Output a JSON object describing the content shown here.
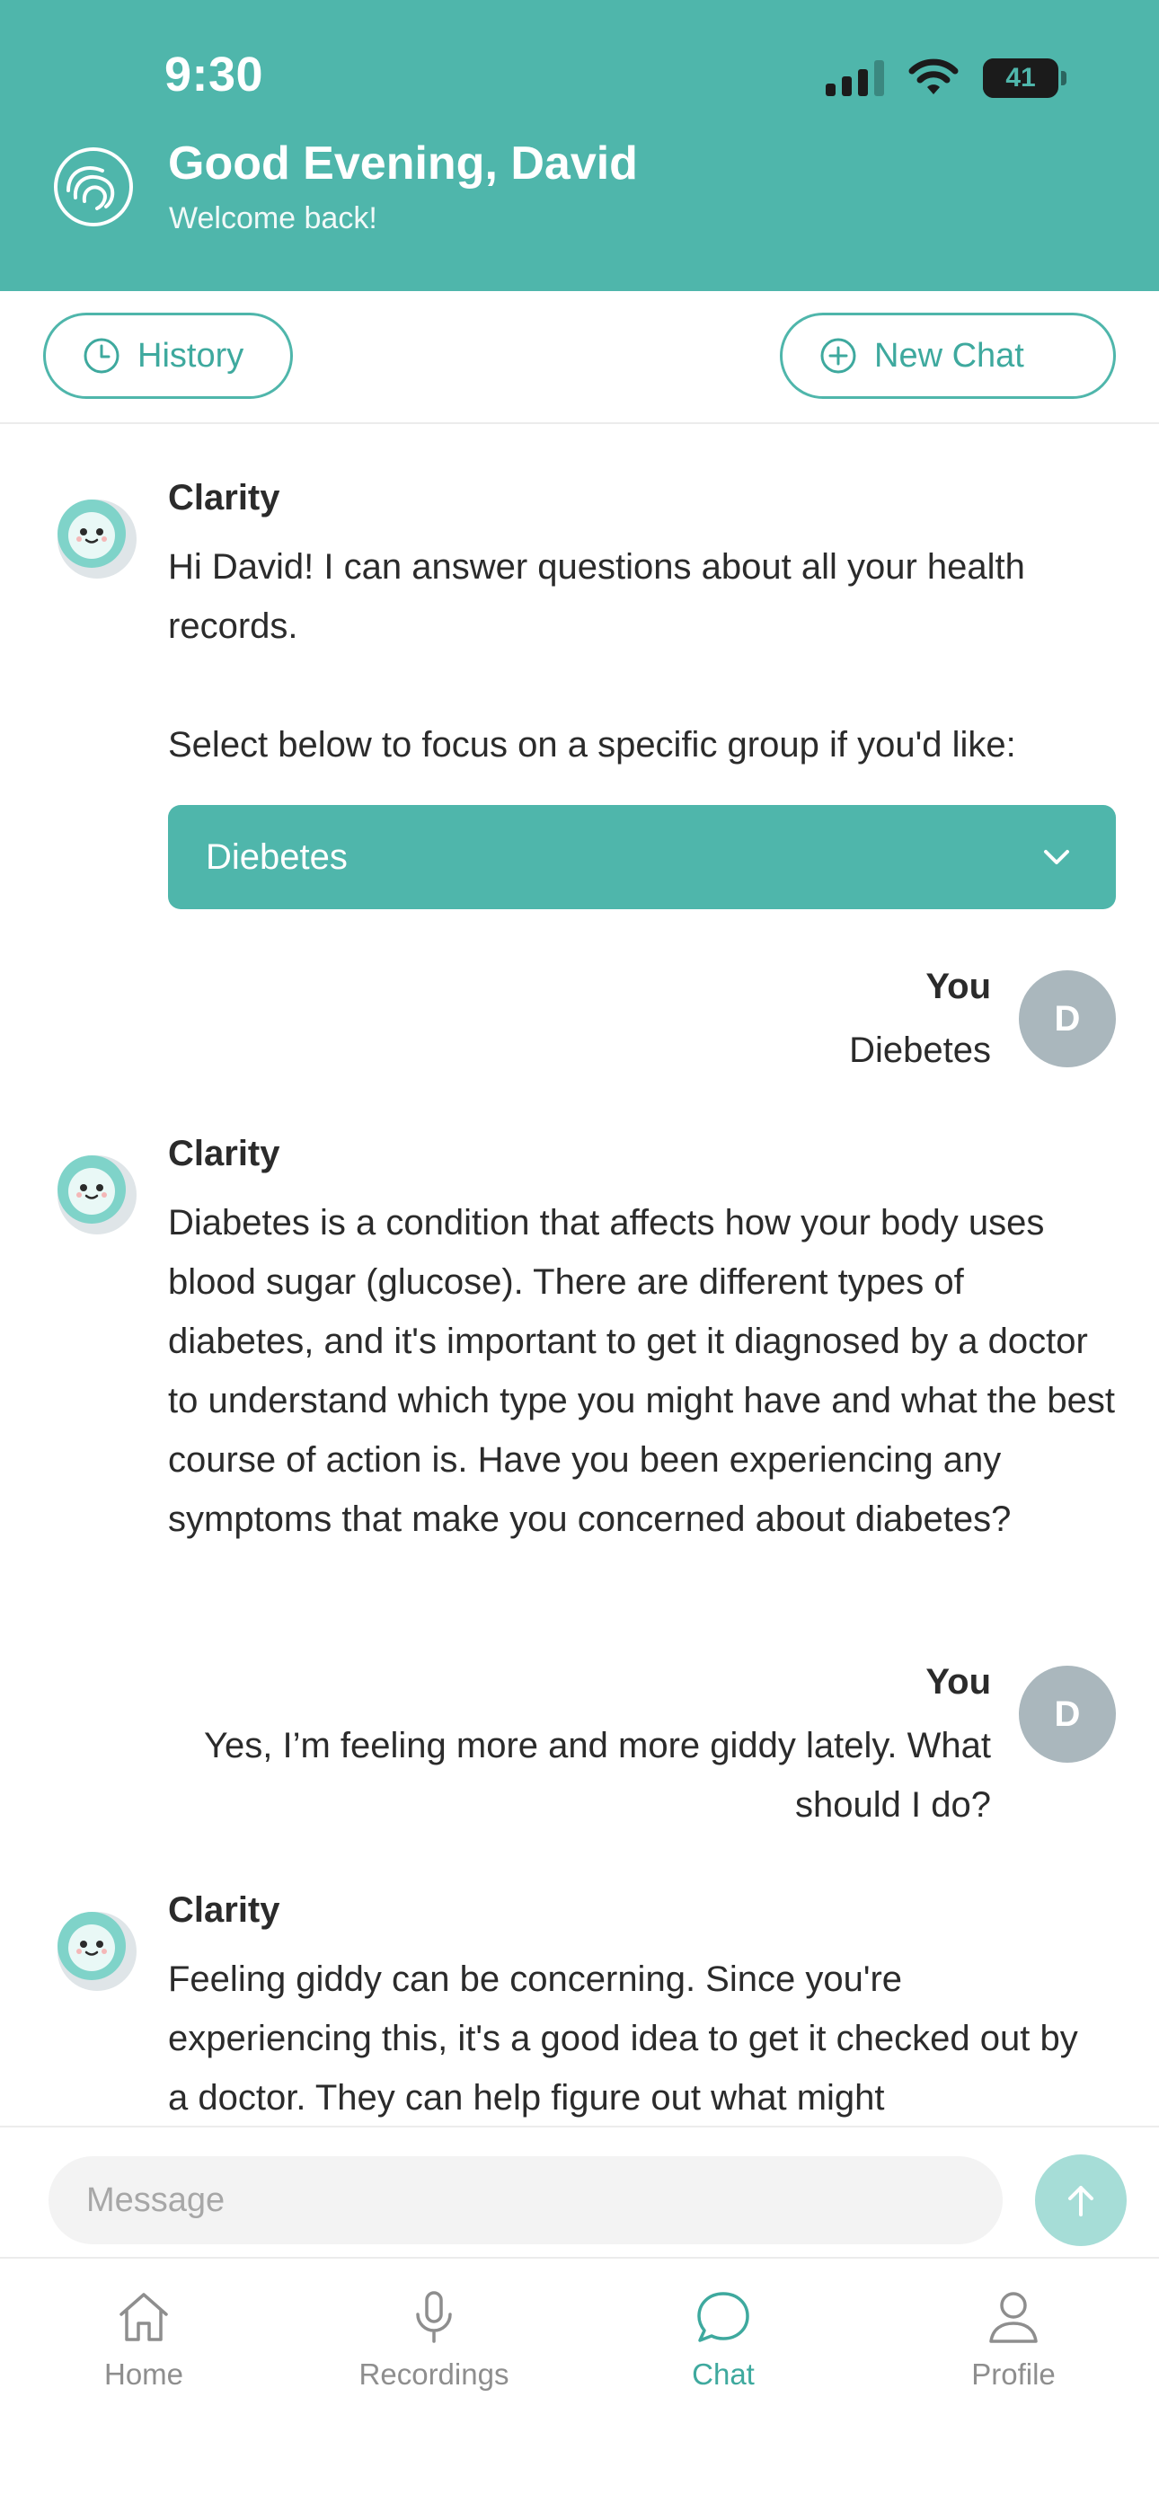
{
  "status_bar": {
    "time": "9:30",
    "battery": "41",
    "battery_level": 0.41
  },
  "header": {
    "greeting": "Good Evening, David",
    "subtitle": "Welcome back!",
    "logo_icon": "swirl-logo-icon"
  },
  "actions": {
    "history_label": "History",
    "history_icon": "clock-icon",
    "new_chat_label": "New Chat",
    "new_chat_icon": "plus-circle-icon"
  },
  "chat": {
    "messages": [
      {
        "sender": "Clarity",
        "text": "Hi David! I can answer questions about all your health records.",
        "text2": "Select below to focus on a specific group if you'd like:"
      },
      {
        "sender": "You",
        "avatar": "D",
        "text": "Diebetes"
      },
      {
        "sender": "Clarity",
        "text": "Diabetes is a condition that affects how your body uses blood sugar (glucose). There are different types of diabetes, and it's important to get it diagnosed by a doctor to understand which type you might have and what the best course of action is. Have you been experiencing any symptoms that make you concerned about diabetes?"
      },
      {
        "sender": "You",
        "avatar": "D",
        "text": "Yes, I’m feeling more and more giddy lately. What should I do?"
      },
      {
        "sender": "Clarity",
        "text": "Feeling giddy can be concerning. Since you're experiencing this, it's a good idea to get it checked out by a doctor. They can help figure out what might"
      }
    ],
    "group_select": {
      "selected": "Diebetes"
    }
  },
  "composer": {
    "placeholder": "Message"
  },
  "tabs": [
    {
      "label": "Home",
      "icon": "home-icon",
      "active": false
    },
    {
      "label": "Recordings",
      "icon": "microphone-icon",
      "active": false
    },
    {
      "label": "Chat",
      "icon": "chat-bubble-icon",
      "active": true
    },
    {
      "label": "Profile",
      "icon": "person-icon",
      "active": false
    }
  ],
  "colors": {
    "brand": "#4fb6ab",
    "brand_light": "#a6ddd7",
    "avatar_user": "#aab7bd",
    "inactive": "#8e8e8e"
  }
}
